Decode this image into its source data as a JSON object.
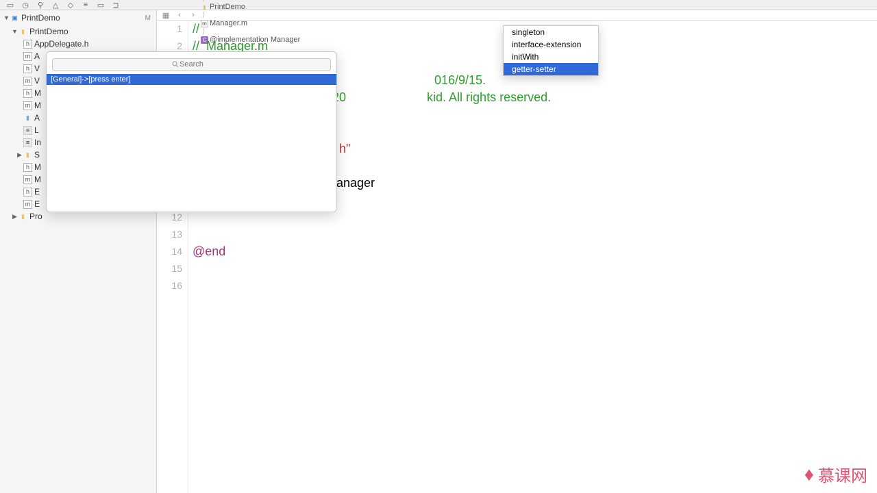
{
  "toolbar_icons": [
    "folder-icon",
    "clock-icon",
    "search-icon",
    "warning-icon",
    "diamond-icon",
    "bars-icon",
    "window-icon",
    "comment-icon"
  ],
  "sidebar": {
    "mod_badge": "M",
    "root": "PrintDemo",
    "group": "PrintDemo",
    "files": [
      {
        "icon": "h",
        "name": "AppDelegate.h"
      },
      {
        "icon": "m",
        "name": "A"
      },
      {
        "icon": "h",
        "name": "V"
      },
      {
        "icon": "m",
        "name": "V"
      },
      {
        "icon": "h",
        "name": "M"
      },
      {
        "icon": "m",
        "name": "M"
      },
      {
        "icon": "bluefolder",
        "name": "A"
      },
      {
        "icon": "nib",
        "name": "L"
      },
      {
        "icon": "nib",
        "name": "In"
      },
      {
        "icon": "folder",
        "name": "S",
        "disclosure": "▶"
      },
      {
        "icon": "h",
        "name": "M"
      },
      {
        "icon": "m",
        "name": "M"
      },
      {
        "icon": "h",
        "name": "E"
      },
      {
        "icon": "m",
        "name": "E"
      }
    ],
    "products": {
      "disclosure": "▶",
      "name": "Pro"
    }
  },
  "jumpbar": {
    "grid": "▦",
    "back": "‹",
    "forward": "›",
    "crumbs": [
      {
        "icon": "proj",
        "label": "PrintDemo"
      },
      {
        "icon": "folder",
        "label": "PrintDemo"
      },
      {
        "icon": "m",
        "label": "Manager.m"
      },
      {
        "icon": "c",
        "label": "@implementation Manager"
      }
    ]
  },
  "code": {
    "lines": {
      "1": "//",
      "2": "//  Manager.m",
      "5a": "016/9/15.",
      "6a": "20",
      "6b": "kid. All rights reserved.",
      "8": "h\"",
      "11": "Manager",
      "15": "@end"
    },
    "gutter_high": "12",
    "gutter": [
      "1",
      "2",
      "",
      "",
      "",
      "",
      "",
      "",
      "",
      "",
      "",
      "12",
      "13",
      "14",
      "15",
      "16"
    ]
  },
  "popover": {
    "placeholder": "Search",
    "result": "[General]->[press enter]"
  },
  "autocomplete": {
    "items": [
      "singleton",
      "interface-extension",
      "initWith",
      "getter-setter"
    ],
    "selected": "getter-setter"
  },
  "watermark": "慕课网"
}
